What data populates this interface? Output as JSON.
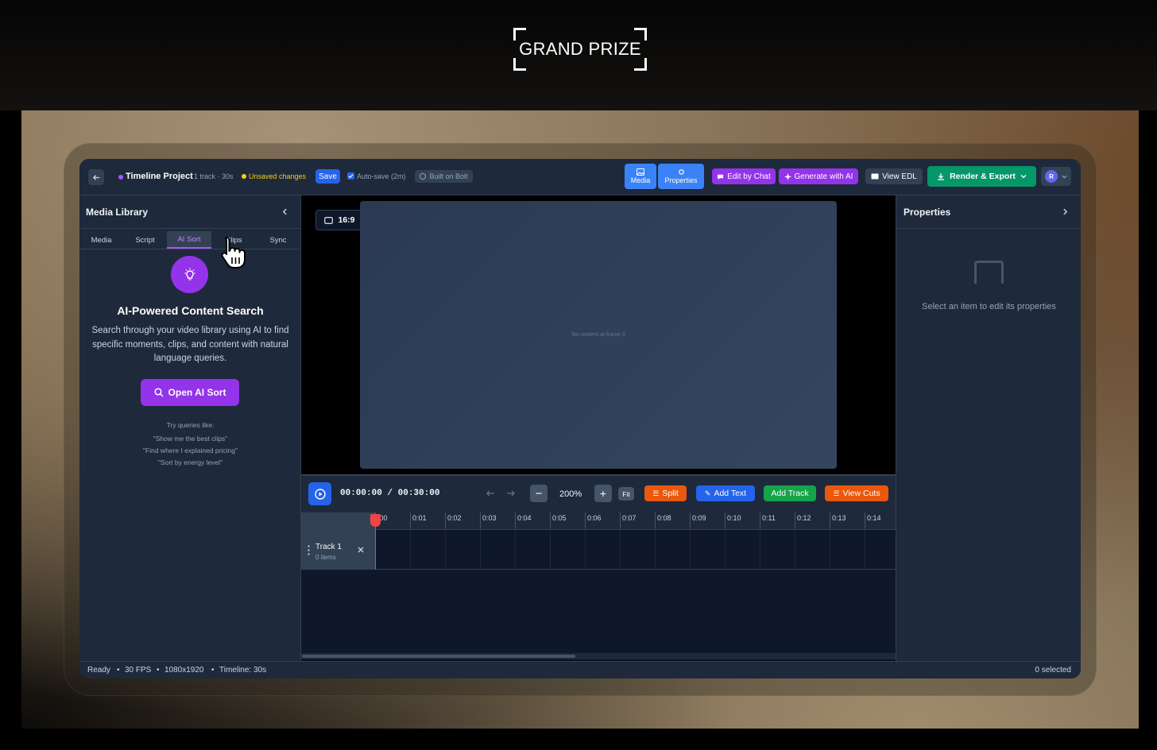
{
  "banner": {
    "title": "GRAND PRIZE"
  },
  "toolbar": {
    "project_title": "Timeline Project",
    "project_meta": "1 track · 30s",
    "unsaved": "Unsaved changes",
    "save_label": "Save",
    "autosave_label": "Auto-save (2m)",
    "built_on": "Built on Bolt",
    "media_label": "Media",
    "properties_label": "Properties",
    "edit_by_chat": "Edit by Chat",
    "generate_ai": "Generate with AI",
    "view_edl": "View EDL",
    "render_export": "Render & Export",
    "avatar_initial": "R"
  },
  "left_panel": {
    "title": "Media Library",
    "tabs": [
      "Media",
      "Script",
      "AI Sort",
      "Clips",
      "Sync"
    ],
    "active_tab": "AI Sort",
    "heading": "AI-Powered Content Search",
    "description": "Search through your video library using AI to find specific moments, clips, and content with natural language queries.",
    "button_label": "Open AI Sort",
    "try_label": "Try queries like:",
    "examples": [
      "\"Show me the best clips\"",
      "\"Find where I explained pricing\"",
      "\"Sort by energy level\""
    ]
  },
  "preview": {
    "aspect": "16:9",
    "empty_text": "No content at frame 0"
  },
  "timeline": {
    "timecode": "00:00:00 / 00:30:00",
    "zoom": "200%",
    "fit_label": "Fit",
    "split_label": "Split",
    "add_text_label": "Add Text",
    "add_track_label": "Add Track",
    "view_cuts_label": "View Cuts",
    "ruler": [
      ":00",
      "0:01",
      "0:02",
      "0:03",
      "0:04",
      "0:05",
      "0:06",
      "0:07",
      "0:08",
      "0:09",
      "0:10",
      "0:11",
      "0:12",
      "0:13",
      "0:14"
    ],
    "tracks": [
      {
        "name": "Track 1",
        "items": "0 items"
      }
    ],
    "scroll_fraction": 0.46
  },
  "right_panel": {
    "title": "Properties",
    "empty_text": "Select an item to edit its properties"
  },
  "status": {
    "left": [
      "Ready",
      "30 FPS",
      "1080x1920",
      "Timeline: 30s"
    ],
    "right": "0 selected"
  },
  "colors": {
    "accent_purple": "#9333ea",
    "accent_blue": "#2563eb",
    "render_green": "#059669",
    "split_orange": "#ea580c",
    "add_track_green": "#16a34a",
    "unsaved_yellow": "#facc15",
    "playhead_red": "#ef4444"
  }
}
